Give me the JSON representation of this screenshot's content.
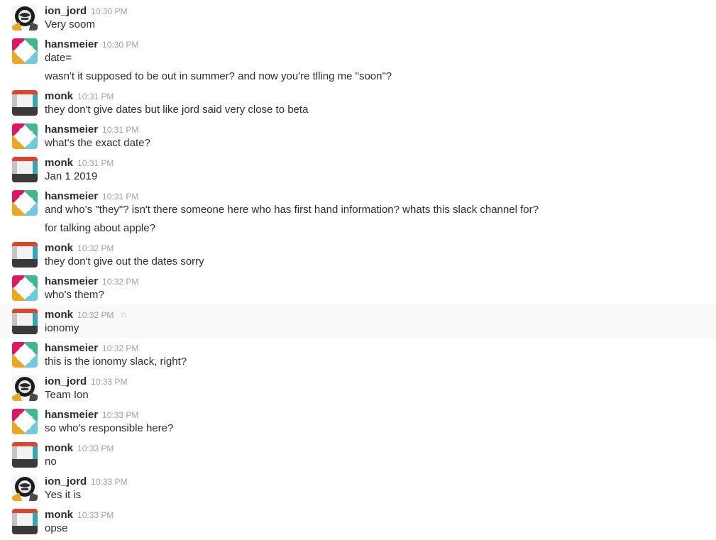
{
  "users": {
    "ion_jord": {
      "name": "ion_jord",
      "avatar_icon": "ion-jord-avatar-icon"
    },
    "hansmeier": {
      "name": "hansmeier",
      "avatar_icon": "slack-logo-avatar-icon"
    },
    "monk": {
      "name": "monk",
      "avatar_icon": "monk-avatar-icon"
    }
  },
  "colors": {
    "author": "#2c2d30",
    "timestamp": "#9e9ea6",
    "hover_background": "#f9f9f9",
    "slack_pink": "#e01563",
    "slack_green": "#3eb890",
    "slack_blue": "#6ecadc",
    "slack_yellow": "#e9a820",
    "monk_red": "#e0442c",
    "monk_teal": "#33a6b8",
    "monk_dark": "#3b3a39"
  },
  "messages": [
    {
      "author": "ion_jord",
      "time": "10:30 PM",
      "lines": [
        "Very soom"
      ]
    },
    {
      "author": "hansmeier",
      "time": "10:30 PM",
      "lines": [
        "date=",
        "wasn't it supposed to be out in summer? and now you're tlling me \"soon\"?"
      ]
    },
    {
      "author": "monk",
      "time": "10:31 PM",
      "lines": [
        "they don't give dates but like jord said very close to beta"
      ]
    },
    {
      "author": "hansmeier",
      "time": "10:31 PM",
      "lines": [
        "what's the exact date?"
      ]
    },
    {
      "author": "monk",
      "time": "10:31 PM",
      "lines": [
        "Jan 1 2019"
      ]
    },
    {
      "author": "hansmeier",
      "time": "10:31 PM",
      "lines": [
        "and who's \"they\"? isn't there someone here who has first hand information? whats this slack channel for?",
        "for talking about apple?"
      ]
    },
    {
      "author": "monk",
      "time": "10:32 PM",
      "lines": [
        "they don't give out the dates sorry"
      ]
    },
    {
      "author": "hansmeier",
      "time": "10:32 PM",
      "lines": [
        "who's them?"
      ]
    },
    {
      "author": "monk",
      "time": "10:32 PM",
      "lines": [
        "ionomy"
      ],
      "hovered": true,
      "star_icon": "star-outline-icon"
    },
    {
      "author": "hansmeier",
      "time": "10:32 PM",
      "lines": [
        "this is the ionomy slack, right?"
      ]
    },
    {
      "author": "ion_jord",
      "time": "10:33 PM",
      "lines": [
        "Team Ion"
      ]
    },
    {
      "author": "hansmeier",
      "time": "10:33 PM",
      "lines": [
        "so who's responsible here?"
      ]
    },
    {
      "author": "monk",
      "time": "10:33 PM",
      "lines": [
        "no"
      ]
    },
    {
      "author": "ion_jord",
      "time": "10:33 PM",
      "lines": [
        "Yes it is"
      ]
    },
    {
      "author": "monk",
      "time": "10:33 PM",
      "lines": [
        "opse"
      ]
    }
  ]
}
